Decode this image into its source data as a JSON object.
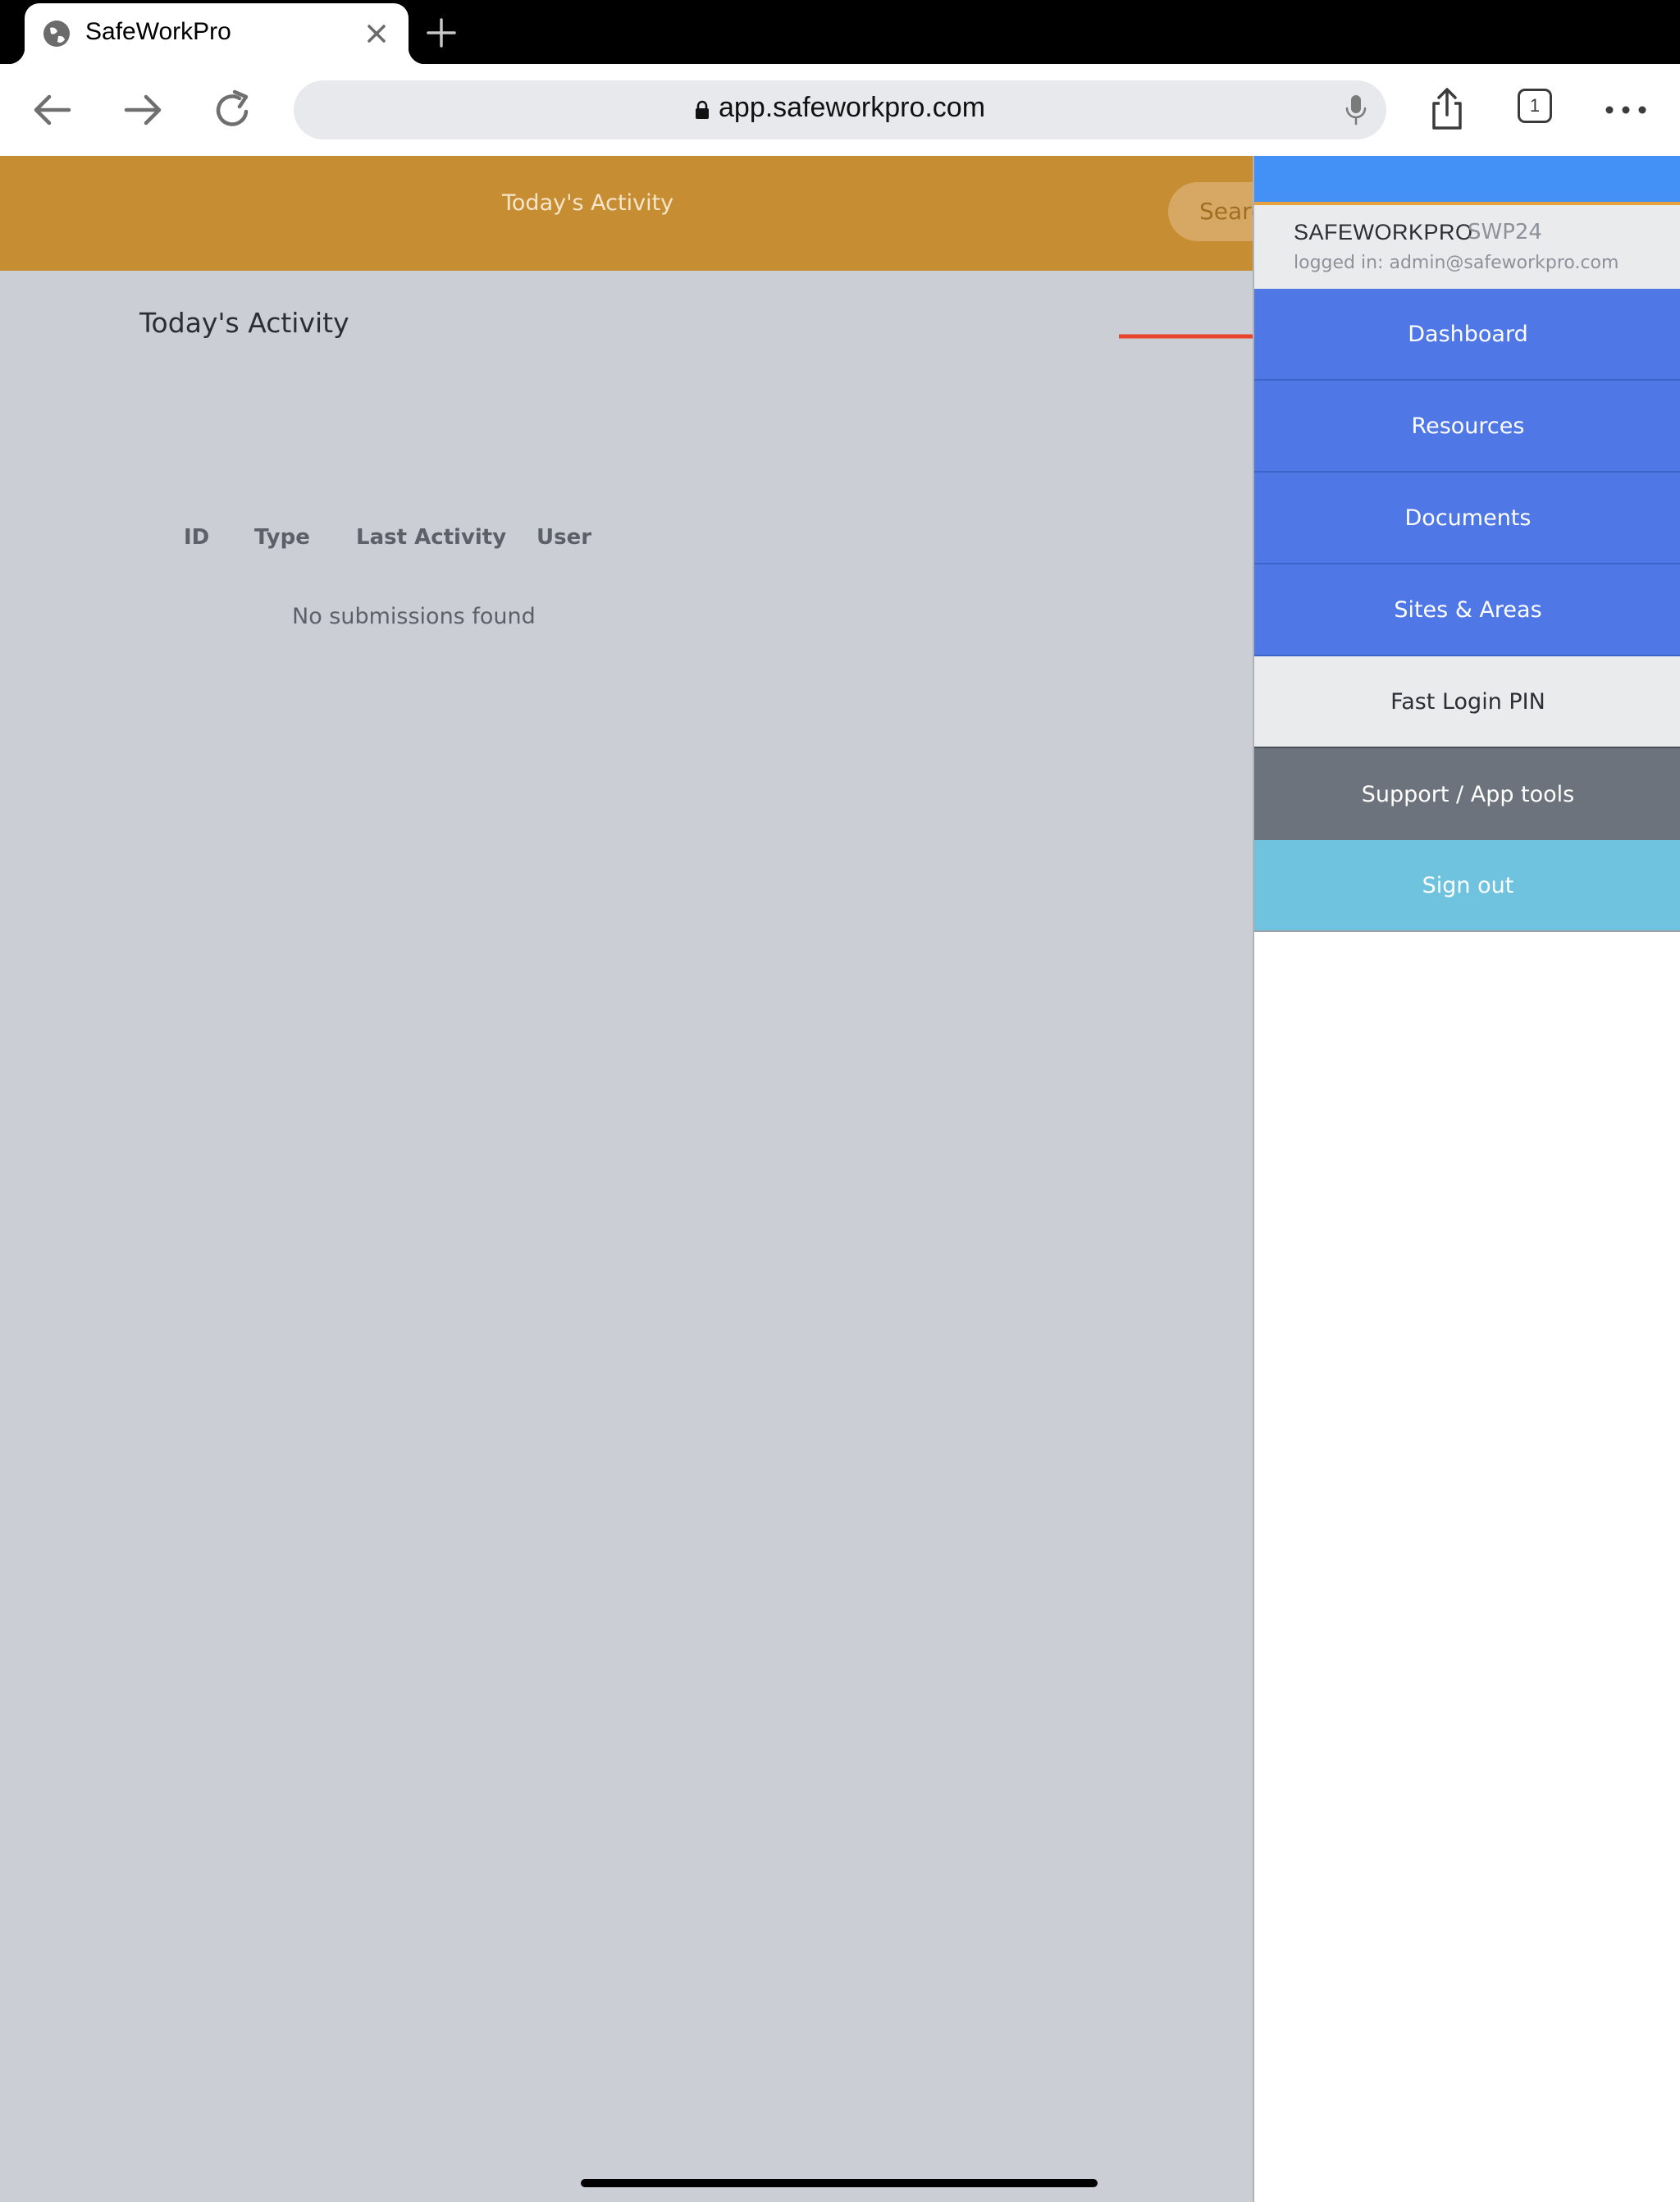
{
  "browser": {
    "tab_title": "SafeWorkPro",
    "url": "app.safeworkpro.com",
    "tab_count": "1"
  },
  "header": {
    "title": "Today's Activity",
    "search_label": "Search"
  },
  "main": {
    "title": "Today's Activity",
    "columns": [
      "ID",
      "Type",
      "Last Activity",
      "User"
    ],
    "empty_message": "No submissions found"
  },
  "sidemenu": {
    "brand": "SAFEWORKPRO",
    "brand_code": "SWP24",
    "logged_in": "logged in: admin@safeworkpro.com",
    "items": [
      {
        "label": "Dashboard"
      },
      {
        "label": "Resources"
      },
      {
        "label": "Documents"
      },
      {
        "label": "Sites & Areas"
      },
      {
        "label": "Fast Login PIN"
      },
      {
        "label": "Support / App tools"
      },
      {
        "label": "Sign out"
      }
    ]
  },
  "colors": {
    "header": "#c78d33",
    "menu_blue": "#4f78e6",
    "menu_gray": "#6c737c",
    "menu_cyan": "#6fc3df",
    "annotation_arrow": "#e8452c",
    "overlay": "#cbced4"
  },
  "icons": [
    "globe-icon",
    "close-icon",
    "plus-icon",
    "back-arrow-icon",
    "forward-arrow-icon",
    "reload-icon",
    "lock-icon",
    "microphone-icon",
    "share-icon",
    "more-icon"
  ]
}
